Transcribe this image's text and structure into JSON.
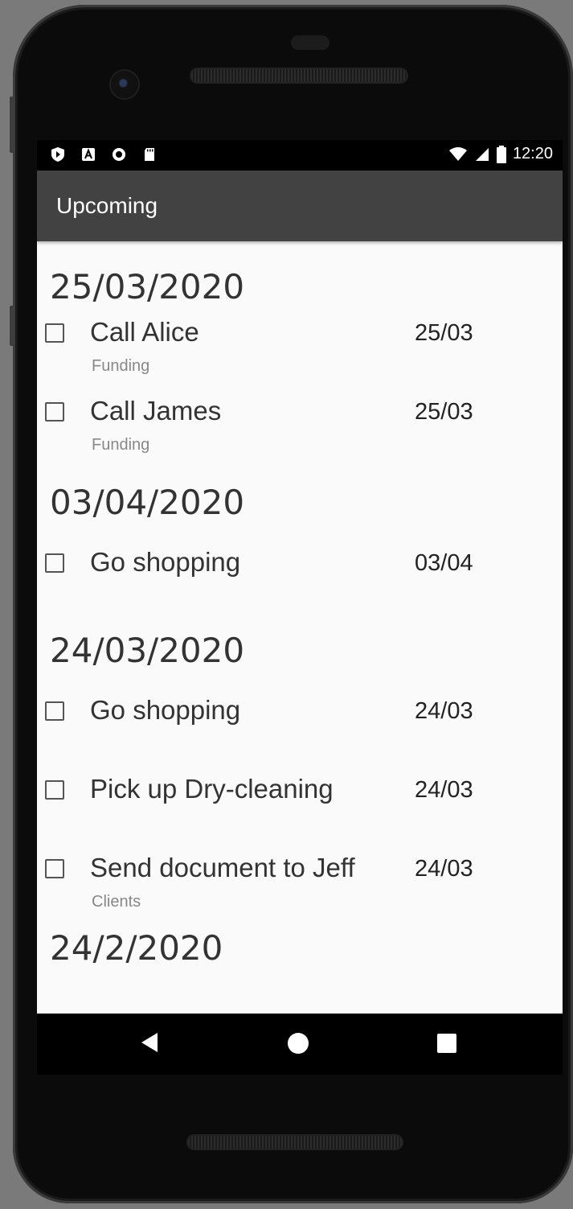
{
  "status_bar": {
    "time": "12:20",
    "left_icons": [
      "shield-icon",
      "a-icon",
      "circle-icon",
      "sdcard-icon"
    ],
    "right_icons": [
      "wifi-icon",
      "signal-icon",
      "battery-icon"
    ]
  },
  "app_bar": {
    "title": "Upcoming"
  },
  "sections": [
    {
      "date": "25/03/2020",
      "tasks": [
        {
          "title": "Call Alice",
          "category": "Funding",
          "date": "25/03"
        },
        {
          "title": "Call James",
          "category": "Funding",
          "date": "25/03"
        }
      ]
    },
    {
      "date": "03/04/2020",
      "tasks": [
        {
          "title": "Go shopping",
          "category": "",
          "date": "03/04"
        }
      ]
    },
    {
      "date": "24/03/2020",
      "tasks": [
        {
          "title": "Go shopping",
          "category": "",
          "date": "24/03"
        },
        {
          "title": "Pick up Dry-cleaning",
          "category": "",
          "date": "24/03"
        },
        {
          "title": "Send document to Jeff",
          "category": "Clients",
          "date": "24/03"
        }
      ]
    },
    {
      "date": "24/2/2020",
      "tasks": []
    }
  ],
  "nav_bar": {
    "icons": [
      "back-icon",
      "home-icon",
      "recents-icon"
    ]
  },
  "colors": {
    "app_bar": "#424242",
    "background": "#fafafa",
    "status_bar": "#000000"
  }
}
